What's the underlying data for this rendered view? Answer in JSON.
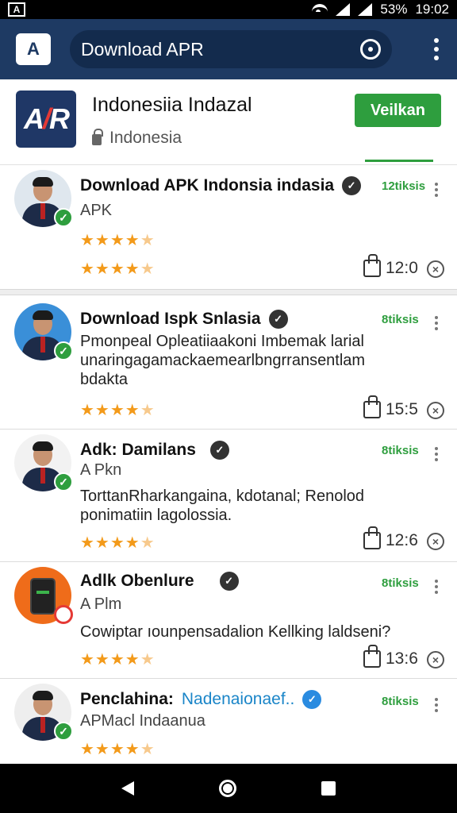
{
  "status_bar": {
    "battery": "53%",
    "time": "19:02",
    "left_icon": "A"
  },
  "app_bar": {
    "app_icon_letter": "A",
    "search_text": "Download APR"
  },
  "header_card": {
    "logo_text": "AR",
    "title": "Indonesiia Indazal",
    "subtitle": "Indonesia",
    "install_button": "Veilkan"
  },
  "items": [
    {
      "title": "Download APK Indonsia indasia",
      "subtitle": "APK",
      "count": "12tiksis",
      "likes": "12:0",
      "rating": "4.5"
    },
    {
      "title": "Download Ispk Snlasia",
      "description": "Pmonpeal Opleatiiaakoni Imbemak larial unaringagamackaemearlbngrransentlam bdakta",
      "count": "8tiksis",
      "likes": "15:5",
      "rating": "4.5"
    },
    {
      "title": "Adk: Damilans",
      "subtitle": "A Pkn",
      "description": "TorttanRharkangaina, kdotanal; Renolod ponimatiin lagolossia.",
      "count": "8tiksis",
      "likes": "12:6",
      "rating": "4.5"
    },
    {
      "title": "Adlk Obenlure",
      "subtitle": "A Plm",
      "description": "Cowiptar ıounpensadalion Kellking laldseni?",
      "count": "8tiksis",
      "likes": "13:6",
      "rating": "4.5"
    },
    {
      "title": "Penclahina:",
      "title_link": "Nadenaionaef..",
      "subtitle": "APMacl Indaanua",
      "count": "8tiksis",
      "rating": "4.5"
    }
  ],
  "colors": {
    "app_bar": "#1e3a63",
    "accent_green": "#2e9e3e",
    "star": "#f39a1a"
  }
}
